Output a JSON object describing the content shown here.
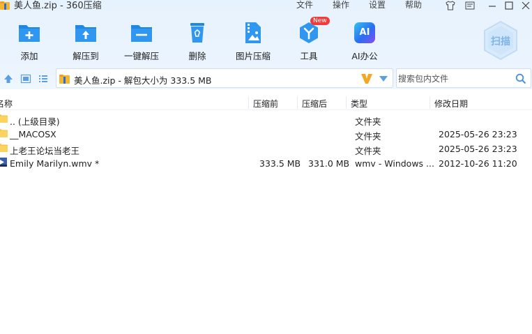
{
  "window": {
    "title": "美人鱼.zip - 360压缩"
  },
  "menu": {
    "file": "文件",
    "operate": "操作",
    "settings": "设置",
    "help": "帮助"
  },
  "toolbar": {
    "add": "添加",
    "extract_to": "解压到",
    "one_click_extract": "一键解压",
    "delete": "删除",
    "image_compress": "图片压缩",
    "tools": "工具",
    "tools_badge": "New",
    "ai_office": "AI办公",
    "ai_icon_text": "AI",
    "scan": "扫描"
  },
  "address": {
    "path": "美人鱼.zip - 解包大小为 333.5 MB"
  },
  "search": {
    "placeholder": "搜索包内文件",
    "value": ""
  },
  "table": {
    "headers": {
      "name": "名称",
      "before": "压缩前",
      "after": "压缩后",
      "type": "类型",
      "modified": "修改日期"
    },
    "rows": [
      {
        "name": ".. (上级目录)",
        "before": "",
        "after": "",
        "type": "文件夹",
        "modified": "",
        "icon": "folder-icon"
      },
      {
        "name": "__MACOSX",
        "before": "",
        "after": "",
        "type": "文件夹",
        "modified": "2025-05-26 23:23",
        "icon": "folder-icon"
      },
      {
        "name": "上老王论坛当老王",
        "before": "",
        "after": "",
        "type": "文件夹",
        "modified": "2025-05-26 23:23",
        "icon": "folder-icon"
      },
      {
        "name": "Emily Marilyn.wmv *",
        "before": "333.5 MB",
        "after": "331.0 MB",
        "type": "wmv - Windows ...",
        "modified": "2012-10-26 11:20",
        "icon": "video-file-icon"
      }
    ]
  },
  "colors": {
    "accent": "#1e88e5",
    "toolbar_bg": "#e8f3fe",
    "folder": "#f7c64a",
    "badge": "#f23b3b"
  }
}
